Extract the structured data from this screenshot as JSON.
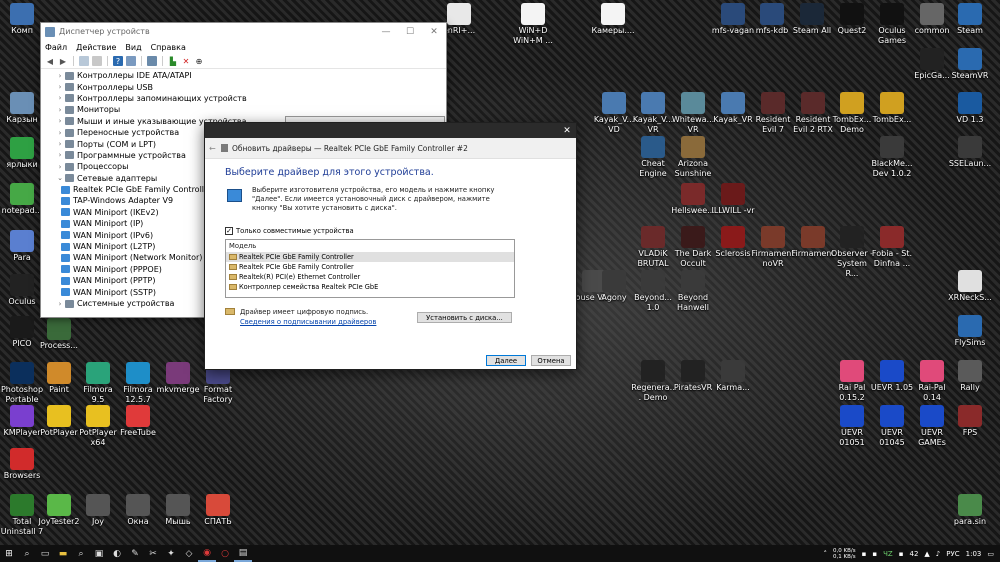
{
  "desktop": {
    "left_icons": [
      {
        "label": "Комп",
        "icon": "computer-icon",
        "color": "#3c6fb0"
      },
      {
        "label": "Карзын",
        "icon": "recycle-bin-icon",
        "color": "#6a8fb5"
      },
      {
        "label": "ярлыки",
        "icon": "shortcut-icon",
        "color": "#2ea043"
      },
      {
        "label": "notepad...",
        "icon": "notepad-icon",
        "color": "#46a846"
      },
      {
        "label": "Para",
        "icon": "para-icon",
        "color": "#5a7fd0"
      },
      {
        "label": "Oculus",
        "icon": "oculus-icon",
        "color": "#222222"
      },
      {
        "label": "PICO",
        "icon": "pico-icon",
        "color": "#1a1a1a"
      },
      {
        "label": "Photoshop Portable",
        "icon": "photoshop-icon",
        "color": "#0b2f5c"
      },
      {
        "label": "KMPlayer",
        "icon": "kmplayer-icon",
        "color": "#7a3fcf"
      },
      {
        "label": "Browsers",
        "icon": "opera-icon",
        "color": "#d12b2b"
      },
      {
        "label": "Total Uninstall 7",
        "icon": "uninstall-icon",
        "color": "#2c7a2c"
      },
      {
        "label": "Process...",
        "icon": "process-icon",
        "color": "#3a6a3a"
      },
      {
        "label": "Paint",
        "icon": "paint-icon",
        "color": "#d08a2a"
      },
      {
        "label": "PotPlayer",
        "icon": "potplayer-icon",
        "color": "#e8c020"
      },
      {
        "label": "JoyTester2",
        "icon": "joytester-icon",
        "color": "#5ab848"
      },
      {
        "label": "Filmora 9.5",
        "icon": "filmora-icon",
        "color": "#2aa37a"
      },
      {
        "label": "PotPlayer x64",
        "icon": "potplayer-icon",
        "color": "#e8c020"
      },
      {
        "label": "Joy",
        "icon": "gamepad-icon",
        "color": "#555555"
      },
      {
        "label": "Filmora 12.5.7",
        "icon": "filmora-icon",
        "color": "#1e8ec8"
      },
      {
        "label": "FreeTube",
        "icon": "freetube-icon",
        "color": "#e03a3a"
      },
      {
        "label": "Окна",
        "icon": "gear-icon",
        "color": "#555555"
      },
      {
        "label": "mkvmerge",
        "icon": "mkvmerge-icon",
        "color": "#7a3a7a"
      },
      {
        "label": "Мышь",
        "icon": "mouse-icon",
        "color": "#555555"
      },
      {
        "label": "Format Factory",
        "icon": "formatfactory-icon",
        "color": "#4a4a8a"
      },
      {
        "label": "СПАТЬ",
        "icon": "power-icon",
        "color": "#d84a3a"
      }
    ],
    "top_icons": [
      {
        "label": "enRI+...",
        "icon": "file-icon",
        "color": "#e8e8e8"
      },
      {
        "label": "WiN+D WiN+M ...",
        "icon": "file-icon",
        "color": "#f4f4f4"
      },
      {
        "label": "Камеры....",
        "icon": "file-icon",
        "color": "#f4f4f4"
      },
      {
        "label": "mfs-vagan",
        "icon": "fs-icon",
        "color": "#2a4a7a"
      },
      {
        "label": "mfs-kdb",
        "icon": "fs-icon",
        "color": "#2a4a7a"
      },
      {
        "label": "Steam All",
        "icon": "steam-icon",
        "color": "#1b2838"
      },
      {
        "label": "Quest2",
        "icon": "quest-icon",
        "color": "#111111"
      },
      {
        "label": "Oculus Games",
        "icon": "oculus-icon",
        "color": "#111111"
      },
      {
        "label": "common",
        "icon": "gamepad-icon",
        "color": "#666666"
      },
      {
        "label": "Steam",
        "icon": "steam-icon",
        "color": "#2a6ab0"
      },
      {
        "label": "EpicGa...",
        "icon": "epic-icon",
        "color": "#222222"
      },
      {
        "label": "SteamVR",
        "icon": "steamvr-icon",
        "color": "#2a6ab0"
      }
    ],
    "right_icons": [
      {
        "label": "Kayak_V... VD",
        "icon": "game-icon",
        "color": "#4a7ab0"
      },
      {
        "label": "Kayak_V... VR",
        "icon": "game-icon",
        "color": "#4a7ab0"
      },
      {
        "label": "Whitewa... VR",
        "icon": "game-icon",
        "color": "#5a8a9a"
      },
      {
        "label": "Kayak_VR",
        "icon": "game-icon",
        "color": "#4a7ab0"
      },
      {
        "label": "Resident Evil 7",
        "icon": "game-icon",
        "color": "#5a2a2a"
      },
      {
        "label": "Resident Evil 2 RTX",
        "icon": "game-icon",
        "color": "#5a2a2a"
      },
      {
        "label": "TombEx... Demo",
        "icon": "game-icon",
        "color": "#d0a020"
      },
      {
        "label": "TombEx...",
        "icon": "game-icon",
        "color": "#d0a020"
      },
      {
        "label": "VD 1.3",
        "icon": "game-icon",
        "color": "#1a5aa0"
      },
      {
        "label": "Cheat Engine",
        "icon": "cheatengine-icon",
        "color": "#2a5a8a"
      },
      {
        "label": "Arizona Sunshine",
        "icon": "game-icon",
        "color": "#8a6a3a"
      },
      {
        "label": "BlackMe... Dev 1.0.2",
        "icon": "game-icon",
        "color": "#3a3a3a"
      },
      {
        "label": "SSELaun...",
        "icon": "game-icon",
        "color": "#3a3a3a"
      },
      {
        "label": "Hellswee...",
        "icon": "game-icon",
        "color": "#7a2a2a"
      },
      {
        "label": "ILLWILL -vr",
        "icon": "game-icon",
        "color": "#6a1a1a"
      },
      {
        "label": "VLADiK BRUTAL",
        "icon": "game-icon",
        "color": "#6a2a2a"
      },
      {
        "label": "The Dark Occult",
        "icon": "game-icon",
        "color": "#3a1a1a"
      },
      {
        "label": "Sclerosis",
        "icon": "game-icon",
        "color": "#8a1a1a"
      },
      {
        "label": "Firmament noVR",
        "icon": "game-icon",
        "color": "#7a3a2a"
      },
      {
        "label": "Firmament",
        "icon": "game-icon",
        "color": "#7a3a2a"
      },
      {
        "label": "Observer - System R...",
        "icon": "game-icon",
        "color": "#222222"
      },
      {
        "label": "Fobia - St. Dinfna ...",
        "icon": "game-icon",
        "color": "#8a2a2a"
      },
      {
        "label": "XRNeckS...",
        "icon": "game-icon",
        "color": "#e0e0e0"
      },
      {
        "label": "ouse Vi...",
        "icon": "game-icon",
        "color": "#4a4a4a"
      },
      {
        "label": "Agony",
        "icon": "game-icon",
        "color": "#3a3a3a"
      },
      {
        "label": "Beyond... 1.0",
        "icon": "game-icon",
        "color": "#3a3a3a"
      },
      {
        "label": "Beyond Hanwell",
        "icon": "game-icon",
        "color": "#3a3a3a"
      },
      {
        "label": "FlySims",
        "icon": "game-icon",
        "color": "#2a6ab0"
      },
      {
        "label": "Regenera... Demo",
        "icon": "unreal-icon",
        "color": "#222222"
      },
      {
        "label": "PiratesVR",
        "icon": "unreal-icon",
        "color": "#222222"
      },
      {
        "label": "Karma...",
        "icon": "game-icon",
        "color": "#3a3a3a"
      },
      {
        "label": "Rai Pal 0.15.2",
        "icon": "raipal-icon",
        "color": "#e04a7a"
      },
      {
        "label": "UEVR 1.05",
        "icon": "uevr-icon",
        "color": "#1a4ac8"
      },
      {
        "label": "Rai-Pal 0.14",
        "icon": "raipal-icon",
        "color": "#e04a7a"
      },
      {
        "label": "Rally",
        "icon": "game-icon",
        "color": "#5a5a5a"
      },
      {
        "label": "UEVR 01051",
        "icon": "uevr-icon",
        "color": "#1a4ac8"
      },
      {
        "label": "UEVR 01045",
        "icon": "uevr-icon",
        "color": "#1a4ac8"
      },
      {
        "label": "UEVR GAMEs",
        "icon": "uevr-icon",
        "color": "#1a4ac8"
      },
      {
        "label": "FPS",
        "icon": "game-icon",
        "color": "#8a2a2a"
      },
      {
        "label": "para.sin",
        "icon": "file-icon",
        "color": "#4a8a4a"
      }
    ]
  },
  "devmgr": {
    "title": "Диспетчер устройств",
    "menu": [
      "Файл",
      "Действие",
      "Вид",
      "Справка"
    ],
    "tree": [
      {
        "label": "Контроллеры IDE ATA/ATAPI",
        "level": "top",
        "arrow": "›"
      },
      {
        "label": "Контроллеры USB",
        "level": "top",
        "arrow": "›"
      },
      {
        "label": "Контроллеры запоминающих устройств",
        "level": "top",
        "arrow": "›"
      },
      {
        "label": "Мониторы",
        "level": "top",
        "arrow": "›"
      },
      {
        "label": "Мыши и иные указывающие устройства",
        "level": "top",
        "arrow": "›"
      },
      {
        "label": "Переносные устройства",
        "level": "top",
        "arrow": "›"
      },
      {
        "label": "Порты (COM и LPT)",
        "level": "top",
        "arrow": "›"
      },
      {
        "label": "Программные устройства",
        "level": "top",
        "arrow": "›"
      },
      {
        "label": "Процессоры",
        "level": "top",
        "arrow": "›"
      },
      {
        "label": "Сетевые адаптеры",
        "level": "top",
        "arrow": "⌄"
      },
      {
        "label": "Realtek PCIe GbE Family Controller",
        "level": "child",
        "arrow": ""
      },
      {
        "label": "TAP-Windows Adapter V9",
        "level": "child",
        "arrow": ""
      },
      {
        "label": "WAN Miniport (IKEv2)",
        "level": "child",
        "arrow": ""
      },
      {
        "label": "WAN Miniport (IP)",
        "level": "child",
        "arrow": ""
      },
      {
        "label": "WAN Miniport (IPv6)",
        "level": "child",
        "arrow": ""
      },
      {
        "label": "WAN Miniport (L2TP)",
        "level": "child",
        "arrow": ""
      },
      {
        "label": "WAN Miniport (Network Monitor)",
        "level": "child",
        "arrow": ""
      },
      {
        "label": "WAN Miniport (PPPOE)",
        "level": "child",
        "arrow": ""
      },
      {
        "label": "WAN Miniport (PPTP)",
        "level": "child",
        "arrow": ""
      },
      {
        "label": "WAN Miniport (SSTP)",
        "level": "child",
        "arrow": ""
      },
      {
        "label": "Системные устройства",
        "level": "top",
        "arrow": "›"
      }
    ]
  },
  "dialog": {
    "title": "Обновить драйверы — Realtek PCIe GbE Family Controller #2",
    "heading": "Выберите драйвер для этого устройства.",
    "instructions": "Выберите изготовителя устройства, его модель и нажмите кнопку \"Далее\". Если имеется установочный диск с драйвером, нажмите кнопку \"Вы хотите установить с диска\".",
    "compatible_label": "Только совместимые устройства",
    "compatible_checked": true,
    "list_header": "Модель",
    "models": [
      "Realtek PCIe GbE Family Controller",
      "Realtek PCIe GbE Family Controller",
      "Realtek(R) PCI(e) Ethernet Controller",
      "Контроллер семейства Realtek PCIe GbE"
    ],
    "signed_text": "Драйвер имеет цифровую подпись.",
    "signed_link": "Сведения о подписывании драйверов",
    "have_disk_button": "Установить с диска...",
    "next_button": "Далее",
    "cancel_button": "Отмена"
  },
  "taskbar": {
    "net_up": "0,0 KB/s",
    "net_down": "0,1 KB/s",
    "temp": "42",
    "lang": "РУС",
    "time": "1:03",
    "tray_label": "ЧZ"
  }
}
